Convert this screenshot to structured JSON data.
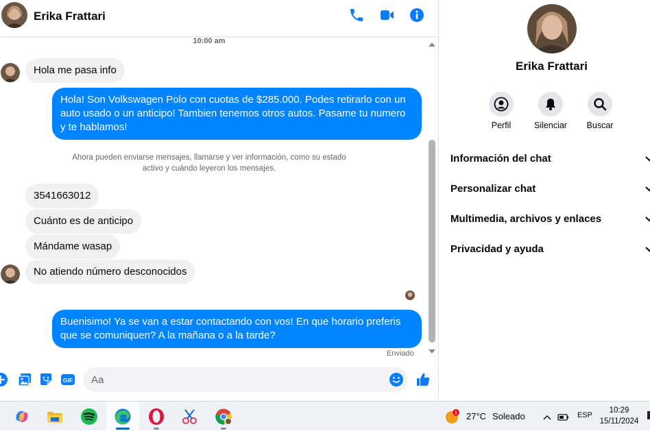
{
  "contact": {
    "name": "Erika Frattari"
  },
  "header": {
    "call_icon": "phone-icon",
    "video_icon": "video-camera-icon",
    "info_icon": "info-icon"
  },
  "colors": {
    "accent": "#0084ff",
    "incoming_bubble": "#f0f0f0",
    "text": "#050505",
    "muted": "#65676b"
  },
  "conversation": {
    "timestamp": "10:00 am",
    "m1": "Hola me pasa info",
    "m2": "Hola! Son Volkswagen Polo con cuotas de $285.000. Podes retirarlo con un auto usado o un anticipo! Tambien tenemos otros autos. Pasame tu numero y te hablamos!",
    "notice": "Ahora pueden enviarse mensajes, llamarse y ver información, como su estado activo y cuándo leyeron los mensajes.",
    "m3": "3541663012",
    "m4": "Cuánto es de anticipo",
    "m5": "Mándame wasap",
    "m6": "No atiendo número desconocidos",
    "m7": "Buenisimo! Ya se van a estar contactando con vos! En que horario preferis que se comuniquen? A la mañana o a la tarde?",
    "status": "Enviado"
  },
  "composer": {
    "placeholder": "Aa",
    "icons": [
      "plus-icon",
      "image-icon",
      "sticker-icon",
      "gif-icon",
      "emoji-icon",
      "like-icon"
    ],
    "gif_label": "GIF"
  },
  "info_panel": {
    "actions": {
      "profile": "Perfil",
      "mute": "Silenciar",
      "search": "Buscar"
    },
    "sections": {
      "chat_info": "Información del chat",
      "customize": "Personalizar chat",
      "media": "Multimedia, archivos y enlaces",
      "privacy": "Privacidad y ayuda"
    }
  },
  "taskbar": {
    "apps": [
      "copilot-icon",
      "file-explorer-icon",
      "spotify-icon",
      "edge-icon",
      "opera-icon",
      "snipping-tool-icon",
      "chrome-icon"
    ],
    "weather": {
      "temp": "27°C",
      "desc": "Soleado",
      "badge": "1"
    },
    "language": "ESP",
    "time": "10:29",
    "date": "15/11/2024"
  }
}
